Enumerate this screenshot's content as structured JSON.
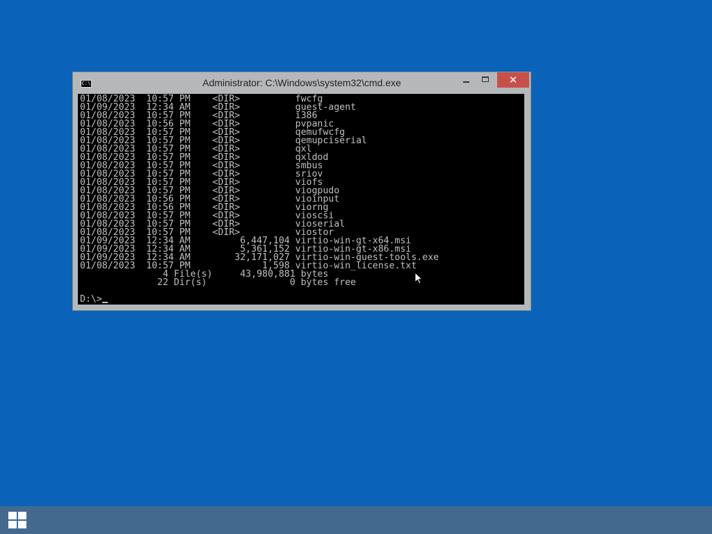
{
  "window": {
    "title": "Administrator: C:\\Windows\\system32\\cmd.exe",
    "icon_text": "C:\\",
    "close_glyph": "✕"
  },
  "console": {
    "lines": [
      "01/08/2023  10:57 PM    <DIR>          fwcfg",
      "01/09/2023  12:34 AM    <DIR>          guest-agent",
      "01/08/2023  10:57 PM    <DIR>          i386",
      "01/08/2023  10:56 PM    <DIR>          pvpanic",
      "01/08/2023  10:57 PM    <DIR>          qemufwcfg",
      "01/08/2023  10:57 PM    <DIR>          qemupciserial",
      "01/08/2023  10:57 PM    <DIR>          qxl",
      "01/08/2023  10:57 PM    <DIR>          qxldod",
      "01/08/2023  10:57 PM    <DIR>          smbus",
      "01/08/2023  10:57 PM    <DIR>          sriov",
      "01/08/2023  10:57 PM    <DIR>          viofs",
      "01/08/2023  10:57 PM    <DIR>          viogpudo",
      "01/08/2023  10:56 PM    <DIR>          vioinput",
      "01/08/2023  10:56 PM    <DIR>          viorng",
      "01/08/2023  10:57 PM    <DIR>          vioscsi",
      "01/08/2023  10:57 PM    <DIR>          vioserial",
      "01/08/2023  10:57 PM    <DIR>          viostor",
      "01/09/2023  12:34 AM         6,447,104 virtio-win-gt-x64.msi",
      "01/09/2023  12:34 AM         5,361,152 virtio-win-gt-x86.msi",
      "01/09/2023  12:34 AM        32,171,027 virtio-win-guest-tools.exe",
      "01/08/2023  10:57 PM             1,598 virtio-win_license.txt",
      "               4 File(s)     43,980,881 bytes",
      "              22 Dir(s)               0 bytes free",
      ""
    ],
    "prompt": "D:\\>"
  },
  "colors": {
    "desktop": "#0a63b9",
    "taskbar": "#43698e",
    "close_button": "#c7504b",
    "window_frame": "#b5b8bb",
    "console_bg": "#000000",
    "console_text": "#c0c0c0"
  },
  "icons": {
    "app": "cmd-app-icon",
    "minimize": "minimize-icon",
    "maximize": "maximize-icon",
    "close": "close-icon",
    "start": "windows-logo-icon",
    "pointer": "mouse-pointer-icon"
  }
}
